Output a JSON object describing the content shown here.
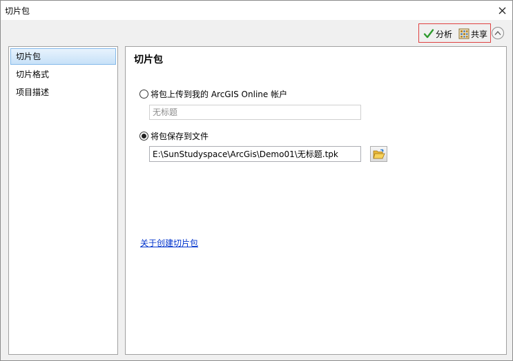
{
  "window": {
    "title": "切片包"
  },
  "toolbar": {
    "analyze_label": "分析",
    "share_label": "共享"
  },
  "sidebar": {
    "items": [
      {
        "label": "切片包",
        "selected": true
      },
      {
        "label": "切片格式",
        "selected": false
      },
      {
        "label": "项目描述",
        "selected": false
      }
    ]
  },
  "main": {
    "title": "切片包",
    "option_upload": {
      "label": "将包上传到我的 ArcGIS Online 帐户",
      "selected": false
    },
    "upload_name_placeholder": "无标题",
    "option_save": {
      "label": "将包保存到文件",
      "selected": true
    },
    "file_path_value": "E:\\SunStudyspace\\ArcGis\\Demo01\\无标题.tpk",
    "help_link": "关于创建切片包"
  },
  "colors": {
    "highlight_border": "#e04040",
    "selected_item_border": "#84b9ea",
    "link": "#0033cc"
  },
  "icons": [
    "close-icon",
    "checkmark-icon",
    "share-grid-icon",
    "chevron-up-icon",
    "folder-open-icon"
  ]
}
